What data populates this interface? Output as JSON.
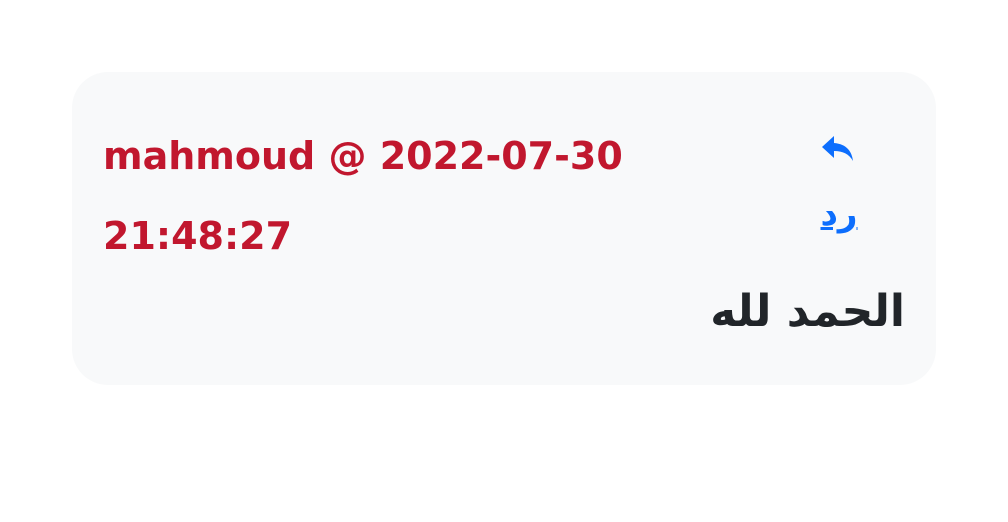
{
  "comment": {
    "author": "mahmoud",
    "separator": "@",
    "date": "2022-07-30",
    "time": "21:48:27",
    "meta": "mahmoud @ 2022-07-30 21:48:27",
    "body": "الحمد لله",
    "reply_label": "رد",
    "reply_icon": "reply-arrow-icon"
  },
  "colors": {
    "meta": "#c1172e",
    "link": "#0d6efd",
    "text": "#212529",
    "card": "#f8f9fa"
  }
}
